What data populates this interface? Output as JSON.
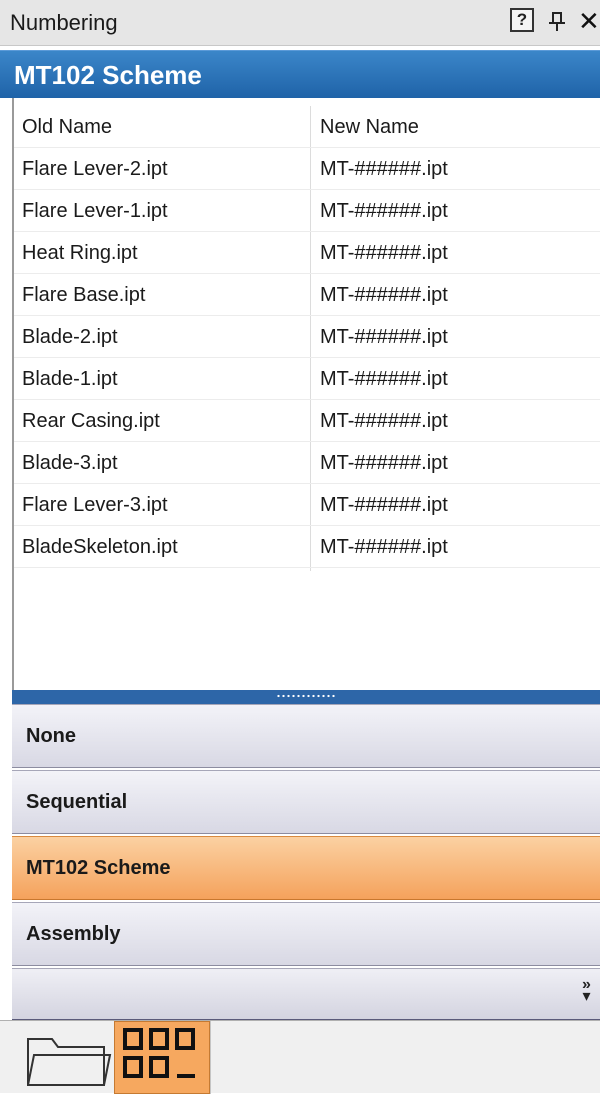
{
  "window": {
    "title": "Numbering",
    "help_label": "?"
  },
  "scheme_header": "MT102 Scheme",
  "table": {
    "columns": [
      "Old Name",
      "New Name"
    ],
    "rows": [
      [
        "Flare Lever-2.ipt",
        "MT-######.ipt"
      ],
      [
        "Flare Lever-1.ipt",
        "MT-######.ipt"
      ],
      [
        "Heat Ring.ipt",
        "MT-######.ipt"
      ],
      [
        "Flare Base.ipt",
        "MT-######.ipt"
      ],
      [
        "Blade-2.ipt",
        "MT-######.ipt"
      ],
      [
        "Blade-1.ipt",
        "MT-######.ipt"
      ],
      [
        "Rear Casing.ipt",
        "MT-######.ipt"
      ],
      [
        "Blade-3.ipt",
        "MT-######.ipt"
      ],
      [
        "Flare Lever-3.ipt",
        "MT-######.ipt"
      ],
      [
        "BladeSkeleton.ipt",
        "MT-######.ipt"
      ]
    ]
  },
  "scheme_list": {
    "items": [
      {
        "label": "None",
        "active": false
      },
      {
        "label": "Sequential",
        "active": false
      },
      {
        "label": "MT102 Scheme",
        "active": true
      },
      {
        "label": "Assembly",
        "active": false
      }
    ],
    "overflow_icon": "chevron-double-right-icon"
  },
  "bottom_tabs": [
    {
      "icon": "folder-icon",
      "active": false
    },
    {
      "icon": "numbering-icon",
      "active": true
    }
  ],
  "colors": {
    "header_blue": "#2a70b6",
    "active_orange": "#f6a85f",
    "nav_gray": "#dcdce6"
  }
}
